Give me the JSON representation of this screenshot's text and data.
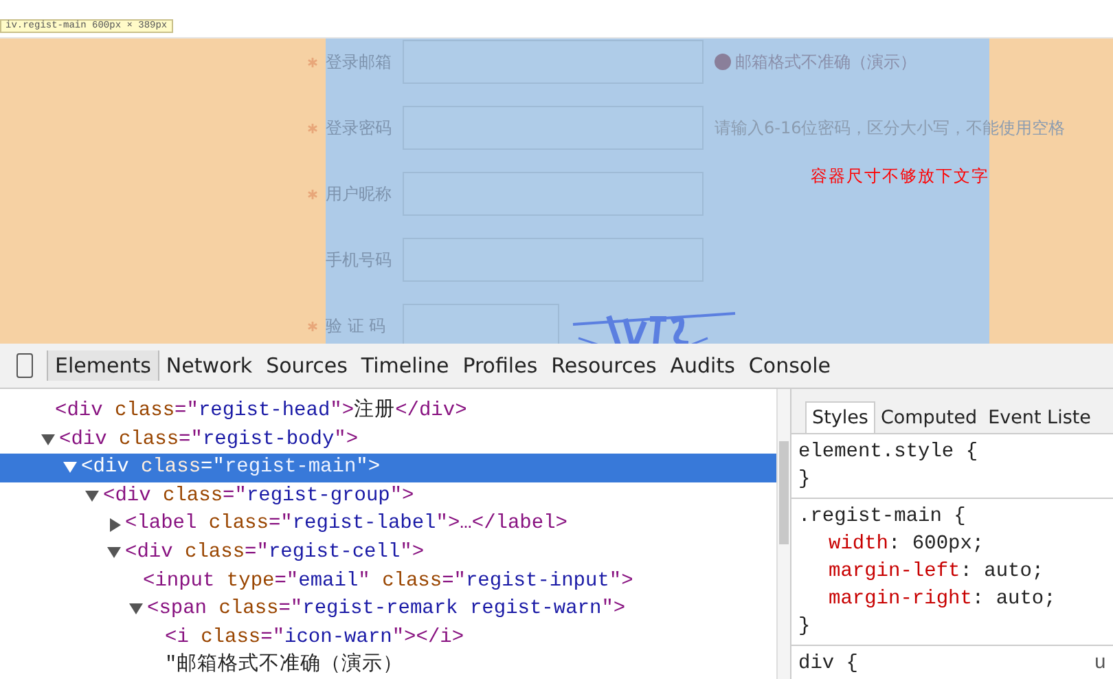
{
  "inspect_tooltip": "iv.regist-main 600px × 389px",
  "form": {
    "fields": [
      {
        "label": "登录邮箱",
        "required": true,
        "kind": "text",
        "remark": {
          "kind": "warn",
          "text": "邮箱格式不准确（演示）"
        }
      },
      {
        "label": "登录密码",
        "required": true,
        "kind": "text",
        "remark": {
          "kind": "hint",
          "text": "请输入6-16位密码，区分大小写，不能使用空格"
        }
      },
      {
        "label": "用户昵称",
        "required": true,
        "kind": "text"
      },
      {
        "label": "手机号码",
        "required": false,
        "kind": "text"
      },
      {
        "label": "验 证 码",
        "required": true,
        "kind": "captcha"
      }
    ]
  },
  "annotation": "容器尺寸不够放下文字",
  "devtools": {
    "tabs": [
      {
        "label": "Elements",
        "selected": true
      },
      {
        "label": "Network",
        "selected": false
      },
      {
        "label": "Sources",
        "selected": false
      },
      {
        "label": "Timeline",
        "selected": false
      },
      {
        "label": "Profiles",
        "selected": false
      },
      {
        "label": "Resources",
        "selected": false
      },
      {
        "label": "Audits",
        "selected": false
      },
      {
        "label": "Console",
        "selected": false
      }
    ],
    "dom_tree": [
      {
        "parts": [
          {
            "kind": "tag",
            "text": "<div "
          },
          {
            "kind": "attr",
            "text": "class"
          },
          {
            "kind": "tag",
            "text": "=\""
          },
          {
            "kind": "value",
            "text": "regist-head"
          },
          {
            "kind": "tag",
            "text": "\">"
          },
          {
            "kind": "text",
            "text": "注册"
          },
          {
            "kind": "tag",
            "text": "</div>"
          }
        ],
        "selected": false
      },
      {
        "parts": [
          {
            "kind": "tag",
            "text": "<div "
          },
          {
            "kind": "attr",
            "text": "class"
          },
          {
            "kind": "tag",
            "text": "=\""
          },
          {
            "kind": "value",
            "text": "regist-body"
          },
          {
            "kind": "tag",
            "text": "\">"
          }
        ],
        "expanded": true,
        "selected": false,
        "children": [
          {
            "parts": [
              {
                "kind": "tag",
                "text": "<div "
              },
              {
                "kind": "attr",
                "text": "class"
              },
              {
                "kind": "tag",
                "text": "=\""
              },
              {
                "kind": "value",
                "text": "regist-main"
              },
              {
                "kind": "tag",
                "text": "\">"
              }
            ],
            "expanded": true,
            "selected": true,
            "children": [
              {
                "parts": [
                  {
                    "kind": "tag",
                    "text": "<div "
                  },
                  {
                    "kind": "attr",
                    "text": "class"
                  },
                  {
                    "kind": "tag",
                    "text": "=\""
                  },
                  {
                    "kind": "value",
                    "text": "regist-group"
                  },
                  {
                    "kind": "tag",
                    "text": "\">"
                  }
                ],
                "expanded": true,
                "selected": false,
                "children": [
                  {
                    "parts": [
                      {
                        "kind": "tag",
                        "text": "<label "
                      },
                      {
                        "kind": "attr",
                        "text": "class"
                      },
                      {
                        "kind": "tag",
                        "text": "=\""
                      },
                      {
                        "kind": "value",
                        "text": "regist-label"
                      },
                      {
                        "kind": "tag",
                        "text": "\">…</label>"
                      }
                    ],
                    "expanded": false,
                    "selected": false
                  },
                  {
                    "parts": [
                      {
                        "kind": "tag",
                        "text": "<div "
                      },
                      {
                        "kind": "attr",
                        "text": "class"
                      },
                      {
                        "kind": "tag",
                        "text": "=\""
                      },
                      {
                        "kind": "value",
                        "text": "regist-cell"
                      },
                      {
                        "kind": "tag",
                        "text": "\">"
                      }
                    ],
                    "expanded": true,
                    "selected": false,
                    "children": [
                      {
                        "parts": [
                          {
                            "kind": "tag",
                            "text": "<input "
                          },
                          {
                            "kind": "attr",
                            "text": "type"
                          },
                          {
                            "kind": "tag",
                            "text": "=\""
                          },
                          {
                            "kind": "value",
                            "text": "email"
                          },
                          {
                            "kind": "tag",
                            "text": "\" "
                          },
                          {
                            "kind": "attr",
                            "text": "class"
                          },
                          {
                            "kind": "tag",
                            "text": "=\""
                          },
                          {
                            "kind": "value",
                            "text": "regist-input"
                          },
                          {
                            "kind": "tag",
                            "text": "\">"
                          }
                        ],
                        "selected": false
                      },
                      {
                        "parts": [
                          {
                            "kind": "tag",
                            "text": "<span "
                          },
                          {
                            "kind": "attr",
                            "text": "class"
                          },
                          {
                            "kind": "tag",
                            "text": "=\""
                          },
                          {
                            "kind": "value",
                            "text": "regist-remark regist-warn"
                          },
                          {
                            "kind": "tag",
                            "text": "\">"
                          }
                        ],
                        "expanded": true,
                        "selected": false,
                        "children": [
                          {
                            "parts": [
                              {
                                "kind": "tag",
                                "text": "<i "
                              },
                              {
                                "kind": "attr",
                                "text": "class"
                              },
                              {
                                "kind": "tag",
                                "text": "=\""
                              },
                              {
                                "kind": "value",
                                "text": "icon-warn"
                              },
                              {
                                "kind": "tag",
                                "text": "\"></i>"
                              }
                            ],
                            "selected": false
                          },
                          {
                            "parts": [
                              {
                                "kind": "text",
                                "text": "\"邮箱格式不准确（演示）"
                              }
                            ],
                            "selected": false
                          }
                        ]
                      }
                    ]
                  }
                ]
              }
            ]
          }
        ]
      }
    ],
    "style_tabs": [
      {
        "label": "Styles",
        "selected": true
      },
      {
        "label": "Computed",
        "selected": false
      },
      {
        "label": "Event Liste",
        "selected": false
      }
    ],
    "style_rules": [
      {
        "selector": "element.style {",
        "close": "}"
      },
      {
        "selector": ".regist-main {",
        "declarations": [
          {
            "property": "width",
            "value": ": 600px;"
          },
          {
            "property": "margin-left",
            "value": ": auto;"
          },
          {
            "property": "margin-right",
            "value": ": auto;"
          }
        ],
        "close": "}"
      },
      {
        "selector": "div {",
        "source": "u"
      }
    ]
  }
}
